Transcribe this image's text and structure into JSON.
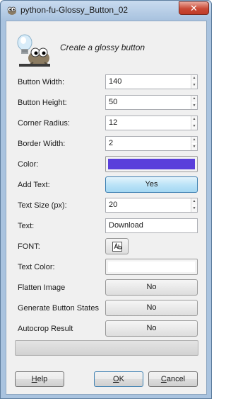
{
  "window": {
    "title": "python-fu-Glossy_Button_02",
    "close_glyph": "✕"
  },
  "header": {
    "description": "Create a glossy button",
    "icon": "gimp-wilber-lightbulb-icon"
  },
  "fields": {
    "button_width": {
      "label": "Button Width:",
      "value": "140"
    },
    "button_height": {
      "label": "Button Height:",
      "value": "50"
    },
    "corner_radius": {
      "label": "Corner Radius:",
      "value": "12"
    },
    "border_width": {
      "label": "Border Width:",
      "value": "2"
    },
    "color": {
      "label": "Color:",
      "swatch": "#5a3fdb"
    },
    "add_text": {
      "label": "Add Text:",
      "value": "Yes"
    },
    "text_size": {
      "label": "Text Size (px):",
      "value": "20"
    },
    "text": {
      "label": "Text:",
      "value": "Download"
    },
    "font": {
      "label": "FONT:",
      "icon": "font-chooser-icon"
    },
    "text_color": {
      "label": "Text Color:",
      "swatch": "#ffffff"
    },
    "flatten_image": {
      "label": "Flatten Image",
      "value": "No"
    },
    "generate_button_states": {
      "label": "Generate Button States",
      "value": "No"
    },
    "autocrop_result": {
      "label": "Autocrop Result",
      "value": "No"
    }
  },
  "progress": {
    "fraction": 0
  },
  "buttons": {
    "help": {
      "mnemonic": "H",
      "rest": "elp"
    },
    "ok": {
      "mnemonic": "O",
      "rest": "K"
    },
    "cancel": {
      "mnemonic": "C",
      "rest": "ancel"
    }
  }
}
